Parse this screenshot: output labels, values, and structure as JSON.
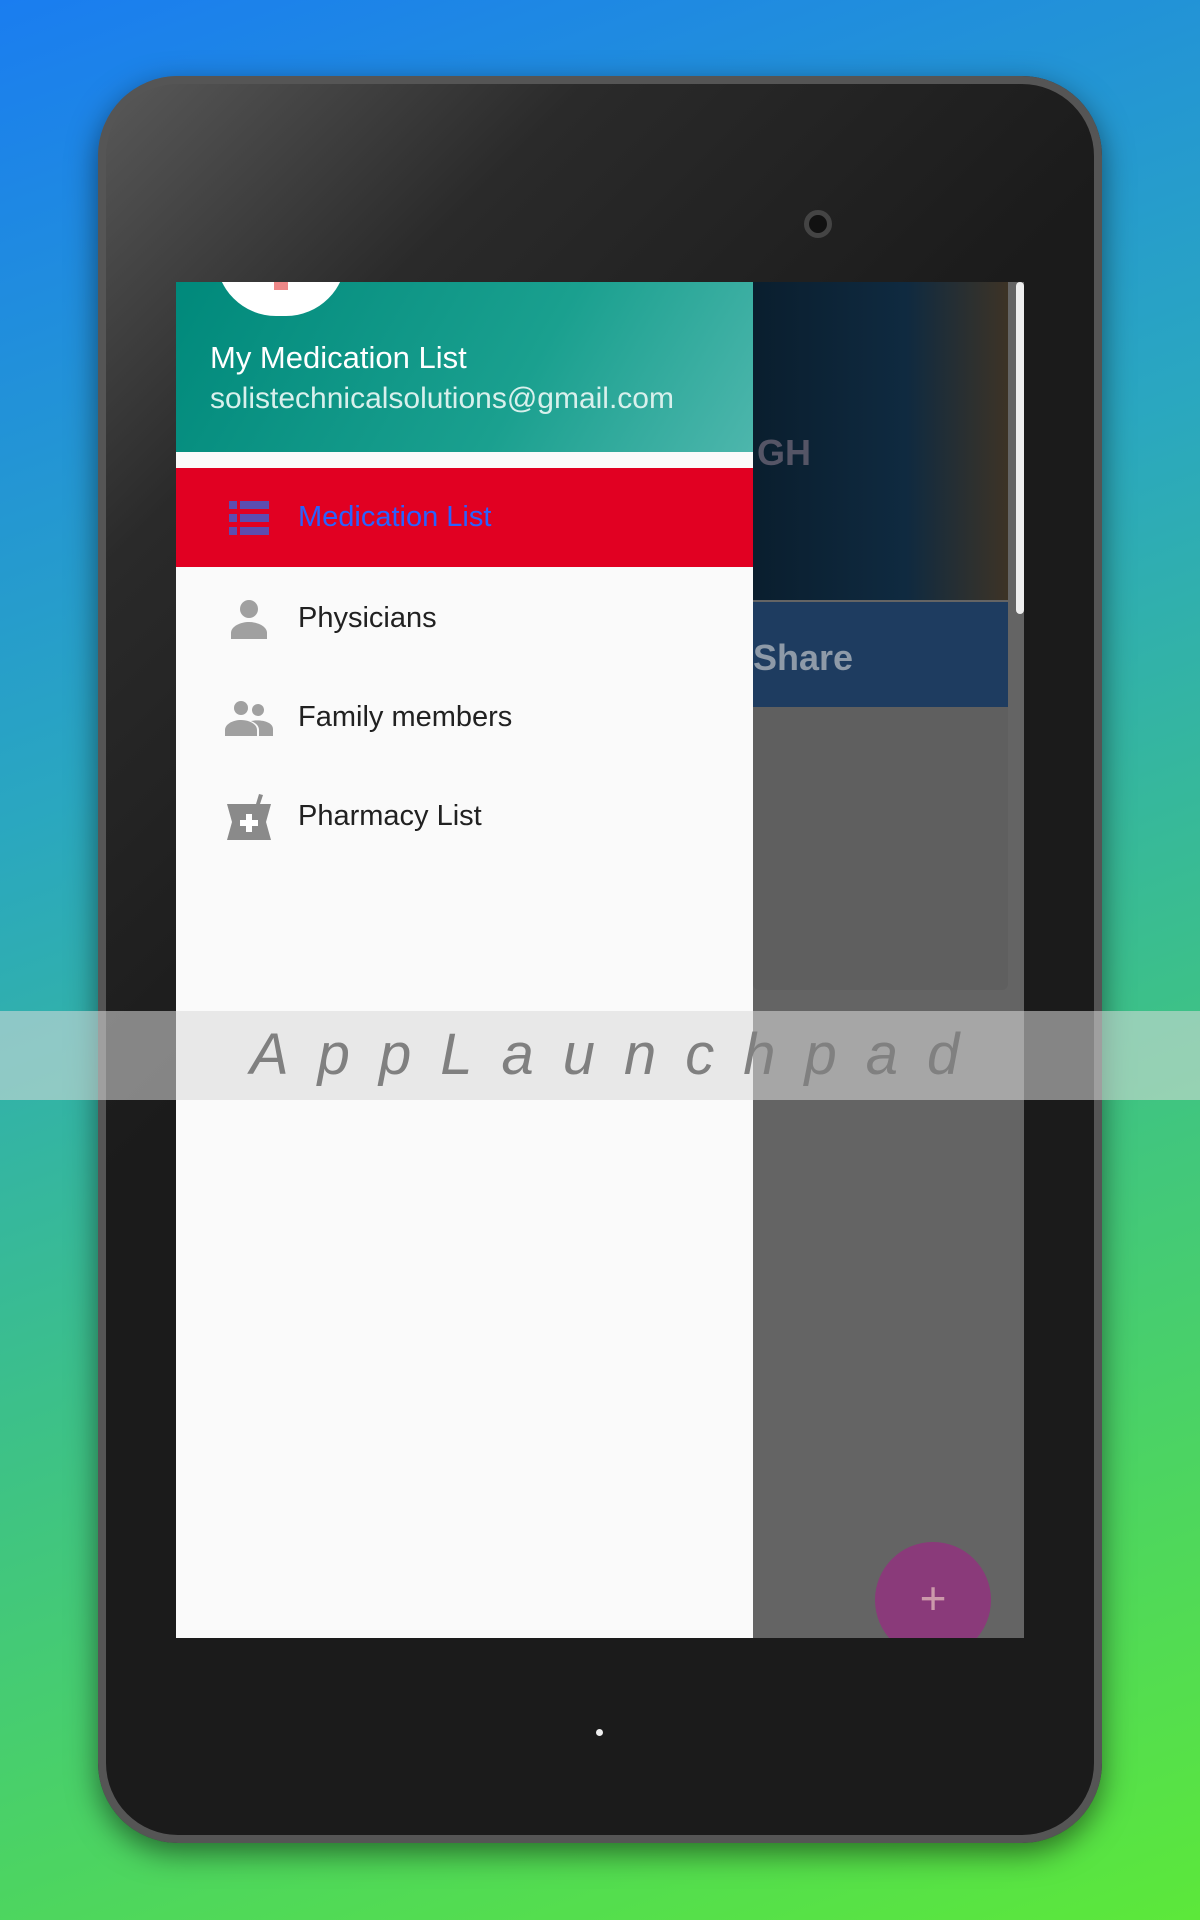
{
  "header": {
    "title": "My Medication List",
    "email": "solistechnicalsolutions@gmail.com"
  },
  "menu": [
    {
      "label": "Medication List",
      "icon": "list-icon",
      "selected": true
    },
    {
      "label": "Physicians",
      "icon": "person-icon"
    },
    {
      "label": "Family members",
      "icon": "people-icon"
    },
    {
      "label": "Pharmacy List",
      "icon": "pharmacy-icon"
    }
  ],
  "background": {
    "share_label": "Share",
    "image_text": "GH",
    "fab": "+"
  },
  "watermark": "AppLaunchpad",
  "colors": {
    "header": "#00897b",
    "selected_bg": "#e10022",
    "selected_text": "#2962ff",
    "fab": "#8a3a7a"
  }
}
